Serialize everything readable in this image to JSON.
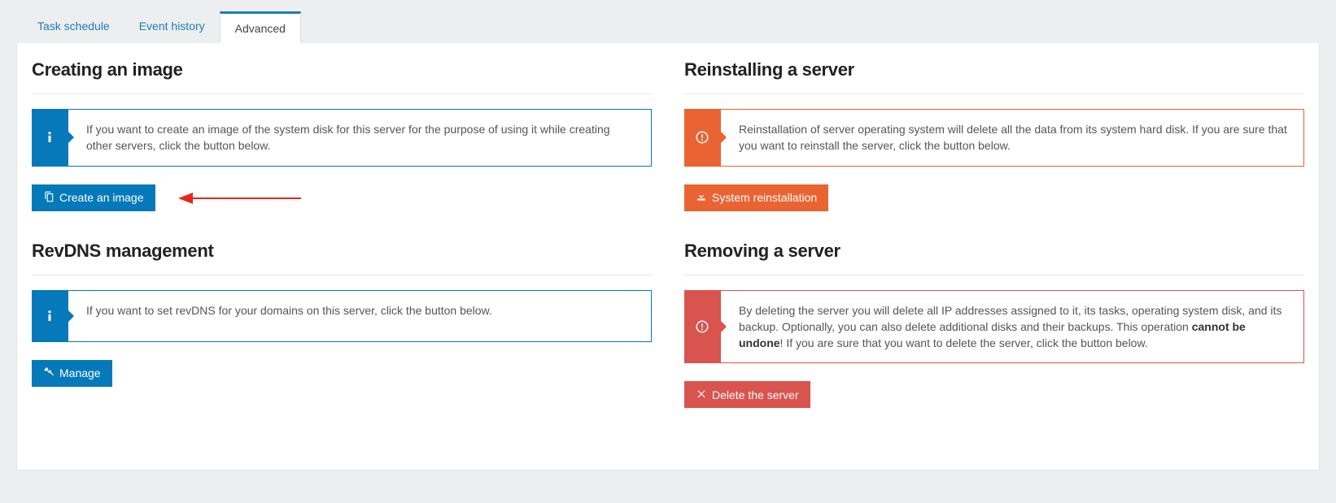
{
  "tabs": {
    "task_schedule": "Task schedule",
    "event_history": "Event history",
    "advanced": "Advanced"
  },
  "left": {
    "creating_image": {
      "title": "Creating an image",
      "info": "If you want to create an image of the system disk for this server for the purpose of using it while creating other servers, click the button below.",
      "button": "Create an image"
    },
    "revdns": {
      "title": "RevDNS management",
      "info": "If you want to set revDNS for your domains on this server, click the button below.",
      "button": "Manage"
    }
  },
  "right": {
    "reinstall": {
      "title": "Reinstalling a server",
      "warn": "Reinstallation of server operating system will delete all the data from its system hard disk. If you are sure that you want to reinstall the server, click the button below.",
      "button": "System reinstallation"
    },
    "remove": {
      "title": "Removing a server",
      "danger_pre": "By deleting the server you will delete all IP addresses assigned to it, its tasks, operating system disk, and its backup. Optionally, you can also delete additional disks and their backups. This operation ",
      "danger_bold": "cannot be undone",
      "danger_post": "! If you are sure that you want to delete the server, click the button below.",
      "button": "Delete the server"
    }
  }
}
